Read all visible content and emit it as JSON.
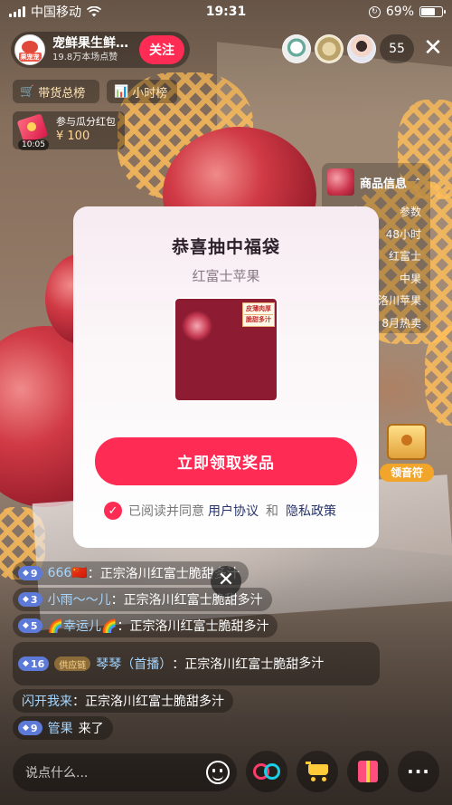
{
  "status_bar": {
    "carrier": "中国移动",
    "time": "19:31",
    "battery": "69%"
  },
  "host": {
    "name": "宠鲜果生鲜…",
    "likes": "19.8万本场点赞",
    "follow_label": "关注",
    "avatar_badge": "果宠宠"
  },
  "viewers": {
    "count": "55"
  },
  "ranks": [
    {
      "label": "带货总榜"
    },
    {
      "label": "小时榜"
    }
  ],
  "red_packet": {
    "title": "参与瓜分红包",
    "amount": "¥ 100",
    "countdown": "10:05"
  },
  "product_panel": {
    "title": "商品信息",
    "rows": [
      "参数",
      "48小时",
      "红富士",
      "中果",
      "洛川苹果",
      "8月热卖"
    ]
  },
  "voucher": {
    "label": "领音符"
  },
  "modal": {
    "title": "恭喜抽中福袋",
    "subtitle": "红富士苹果",
    "prize_tag_line1": "皮薄肉厚",
    "prize_tag_line2": "脆甜多汁",
    "claim_label": "立即领取奖品",
    "agree_prefix": "已阅读并同意",
    "user_agreement": "用户协议",
    "and": "和",
    "privacy_policy": "隐私政策"
  },
  "chat": [
    {
      "level": "9",
      "user": "666🇨🇳",
      "content": "正宗洛川红富士脆甜多汁"
    },
    {
      "level": "3",
      "user": "小雨～～儿",
      "content": "正宗洛川红富士脆甜多汁"
    },
    {
      "level": "5",
      "user": "🌈幸运儿🌈",
      "content": "正宗洛川红富士脆甜多汁"
    },
    {
      "level": "16",
      "badge": "供应链",
      "user": "琴琴（首播）",
      "content": "正宗洛川红富士脆甜",
      "content_line2": "多汁"
    },
    {
      "user": "闪开我来",
      "content": "正宗洛川红富士脆甜多汁"
    },
    {
      "level": "9",
      "user": "管果",
      "content": "来了"
    }
  ],
  "input": {
    "placeholder": "说点什么..."
  },
  "colors": {
    "accent": "#fe2c55",
    "link": "#27346b"
  }
}
